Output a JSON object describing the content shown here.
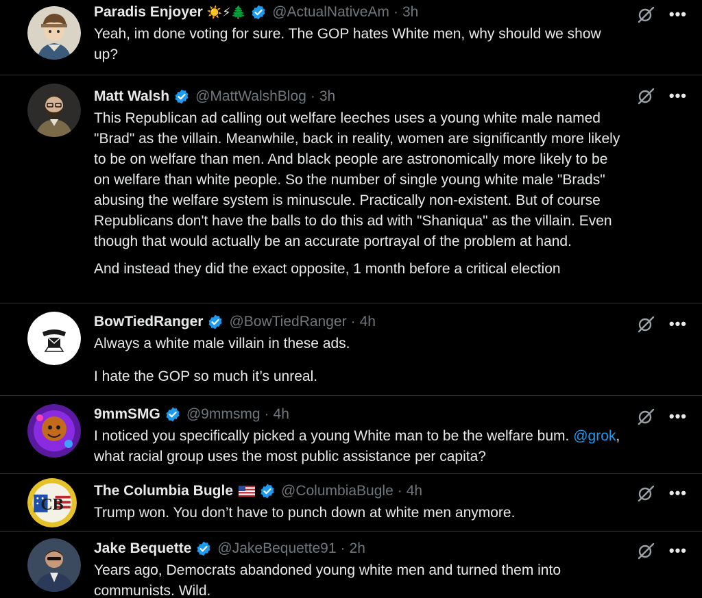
{
  "colors": {
    "background": "#000000",
    "text": "#e7e9ea",
    "muted": "#71767b",
    "link": "#1d9bf0",
    "verified": "#1d9bf0",
    "divider": "#2f3336"
  },
  "tweets": [
    {
      "name": "Paradis Enjoyer",
      "emoji": "☀️⚡🌲",
      "handle": "@ActualNativeAm",
      "separator": "·",
      "time": "3h",
      "paragraphs": [
        "Yeah, im done voting for sure. The GOP hates  White men, why should we show up?"
      ]
    },
    {
      "name": "Matt Walsh",
      "handle": "@MattWalshBlog",
      "separator": "·",
      "time": "3h",
      "paragraphs": [
        "This Republican ad calling out welfare leeches uses a young white male named \"Brad\" as the villain. Meanwhile, back in reality, women are significantly more likely to be on welfare than men. And black people are astronomically more likely to be on welfare than white people. So the number of single young white male \"Brads\" abusing the welfare system is minuscule. Practically non-existent. But of course Republicans don't have the balls to do this ad with \"Shaniqua\" as the villain. Even though that would actually be an accurate portrayal of the problem at hand.",
        "And instead they did the exact opposite, 1 month before a critical election"
      ]
    },
    {
      "name": "BowTiedRanger",
      "handle": "@BowTiedRanger",
      "separator": "·",
      "time": "4h",
      "paragraphs": [
        "Always a white male villain in these ads.",
        "I hate the GOP so much it’s unreal."
      ]
    },
    {
      "name": "9mmSMG",
      "handle": "@9mmsmg",
      "separator": "·",
      "time": "4h",
      "text_before_link": "I noticed you specifically picked a young White man to be the welfare bum.",
      "mention": "@grok",
      "text_after_link": ", what racial group uses the most public assistance per capita?"
    },
    {
      "name": "The Columbia Bugle",
      "emoji_icon": "us-flag-icon",
      "handle": "@ColumbiaBugle",
      "separator": "·",
      "time": "4h",
      "paragraphs": [
        "Trump won. You don’t have to punch down at white men anymore."
      ]
    },
    {
      "name": "Jake Bequette",
      "handle": "@JakeBequette91",
      "separator": "·",
      "time": "2h",
      "paragraphs": [
        "Years ago, Democrats abandoned young white men and turned them into communists. Wild."
      ]
    }
  ],
  "action_icons": {
    "grok": "grok-icon",
    "more": "more-icon",
    "more_glyph": "•••"
  }
}
